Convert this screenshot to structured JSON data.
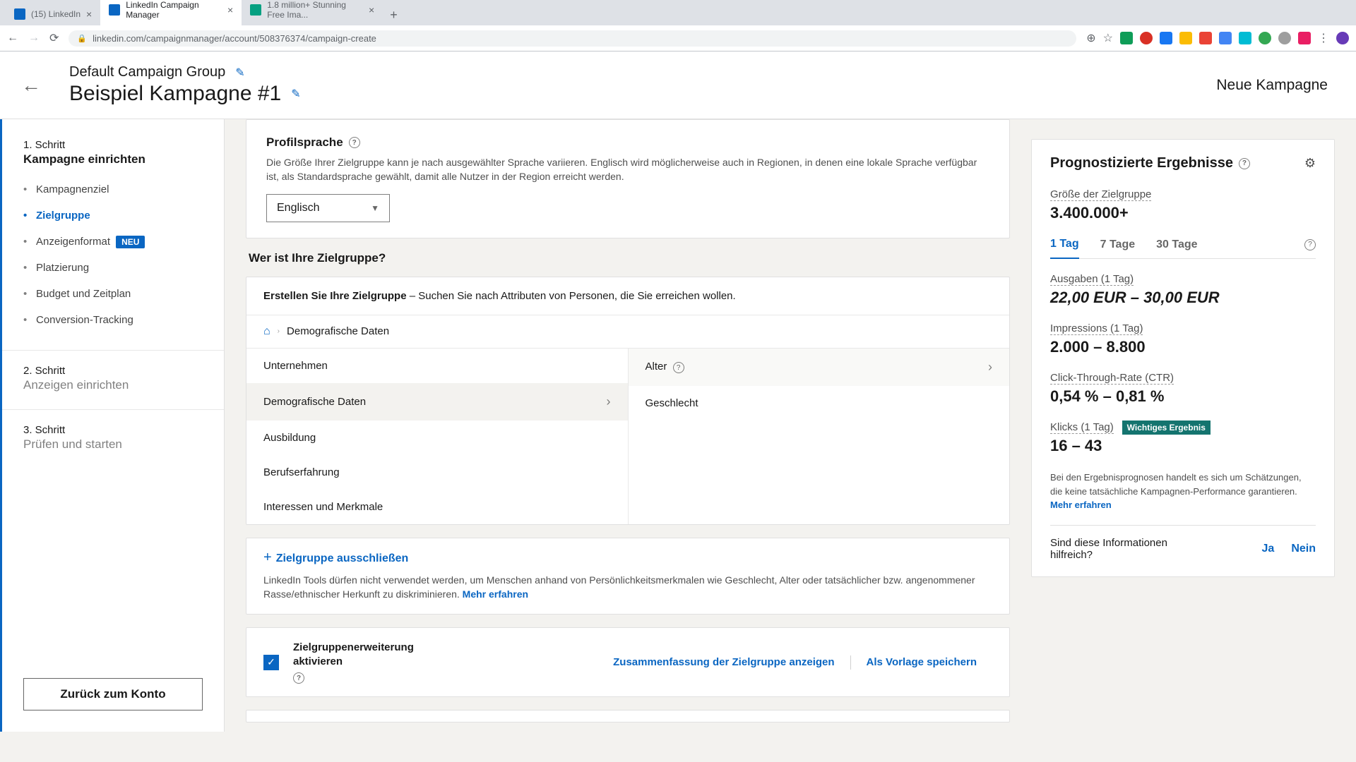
{
  "browser": {
    "tabs": [
      {
        "title": "(15) LinkedIn"
      },
      {
        "title": "LinkedIn Campaign Manager"
      },
      {
        "title": "1.8 million+ Stunning Free Ima..."
      }
    ],
    "url": "linkedin.com/campaignmanager/account/508376374/campaign-create"
  },
  "header": {
    "group": "Default Campaign Group",
    "campaign": "Beispiel Kampagne #1",
    "new_campaign": "Neue Kampagne"
  },
  "sidebar": {
    "step1_label": "1. Schritt",
    "step1_title": "Kampagne einrichten",
    "items": [
      {
        "label": "Kampagnenziel"
      },
      {
        "label": "Zielgruppe"
      },
      {
        "label": "Anzeigenformat"
      },
      {
        "label": "Platzierung"
      },
      {
        "label": "Budget und Zeitplan"
      },
      {
        "label": "Conversion-Tracking"
      }
    ],
    "badge_new": "NEU",
    "step2_label": "2. Schritt",
    "step2_title": "Anzeigen einrichten",
    "step3_label": "3. Schritt",
    "step3_title": "Prüfen und starten",
    "back_account": "Zurück zum Konto"
  },
  "profile_lang": {
    "title": "Profilsprache",
    "desc": "Die Größe Ihrer Zielgruppe kann je nach ausgewählter Sprache variieren. Englisch wird möglicherweise auch in Regionen, in denen eine lokale Sprache verfügbar ist, als Standardsprache gewählt, damit alle Nutzer in der Region erreicht werden.",
    "selected": "Englisch"
  },
  "audience": {
    "question": "Wer ist Ihre Zielgruppe?",
    "builder_head_bold": "Erstellen Sie Ihre Zielgruppe",
    "builder_head_rest": " – Suchen Sie nach Attributen von Personen, die Sie erreichen wollen.",
    "crumb": "Demografische Daten",
    "categories": [
      "Unternehmen",
      "Demografische Daten",
      "Ausbildung",
      "Berufserfahrung",
      "Interessen und Merkmale"
    ],
    "subcats": [
      "Alter",
      "Geschlecht"
    ],
    "exclude": "Zielgruppe ausschließen",
    "policy": "LinkedIn Tools dürfen nicht verwendet werden, um Menschen anhand von Persönlichkeitsmerkmalen wie Geschlecht, Alter oder tatsächlicher bzw. angenommener Rasse/ethnischer Herkunft zu diskriminieren. ",
    "policy_link": "Mehr erfahren",
    "expansion_label": "Zielgruppenerweiterung aktivieren",
    "summary_link": "Zusammenfassung der Zielgruppe anzeigen",
    "save_template": "Als Vorlage speichern"
  },
  "forecast": {
    "title": "Prognostizierte Ergebnisse",
    "size_label": "Größe der Zielgruppe",
    "size_value": "3.400.000+",
    "tabs": [
      "1 Tag",
      "7 Tage",
      "30 Tage"
    ],
    "spend_label": "Ausgaben (1 Tag)",
    "spend_value": "22,00 EUR – 30,00 EUR",
    "impr_label": "Impressions (1 Tag)",
    "impr_value": "2.000 – 8.800",
    "ctr_label": "Click-Through-Rate (CTR)",
    "ctr_value": "0,54 % – 0,81 %",
    "clicks_label": "Klicks (1 Tag)",
    "clicks_value": "16 – 43",
    "important_badge": "Wichtiges Ergebnis",
    "note": "Bei den Ergebnisprognosen handelt es sich um Schätzungen, die keine tatsächliche Kampagnen-Performance garantieren. ",
    "note_link": "Mehr erfahren",
    "helpful_q": "Sind diese Informationen hilfreich?",
    "yes": "Ja",
    "no": "Nein"
  }
}
